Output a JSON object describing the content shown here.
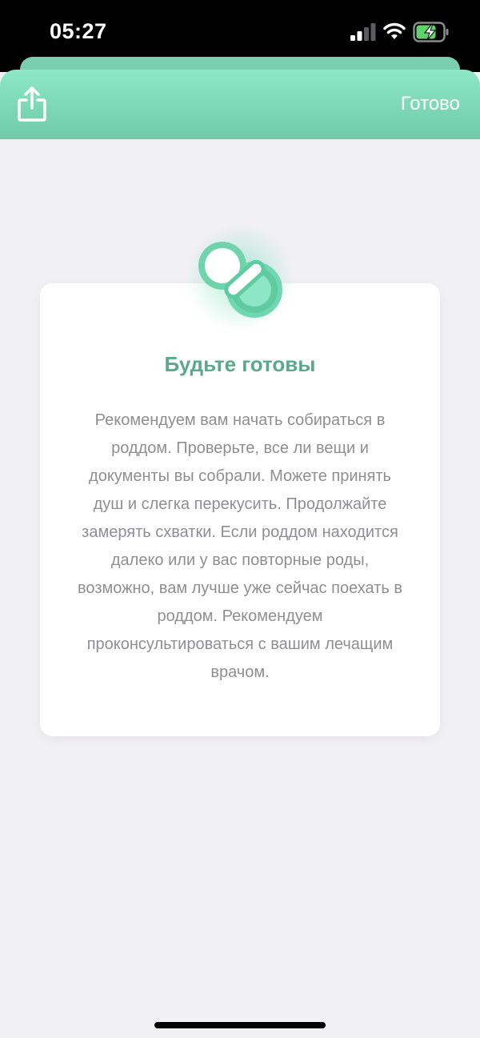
{
  "status_bar": {
    "time": "05:27"
  },
  "header": {
    "done_label": "Готово",
    "share_icon": "share-icon"
  },
  "card": {
    "icon": "pacifier-icon",
    "title": "Будьте готовы",
    "body": "Рекомендуем вам начать собираться в роддом. Проверьте, все ли вещи и документы вы собрали. Можете принять душ и слегка перекусить. Продолжайте замерять схватки. Если роддом находится далеко или у вас повторные роды, возможно, вам лучше уже сейчас поехать в роддом. Рекомендуем проконсультироваться с вашим лечащим врачом."
  },
  "colors": {
    "accent": "#6fcaa7",
    "title": "#5aaa8a",
    "background": "#f1f0f5",
    "body_text": "#8e8e93"
  }
}
